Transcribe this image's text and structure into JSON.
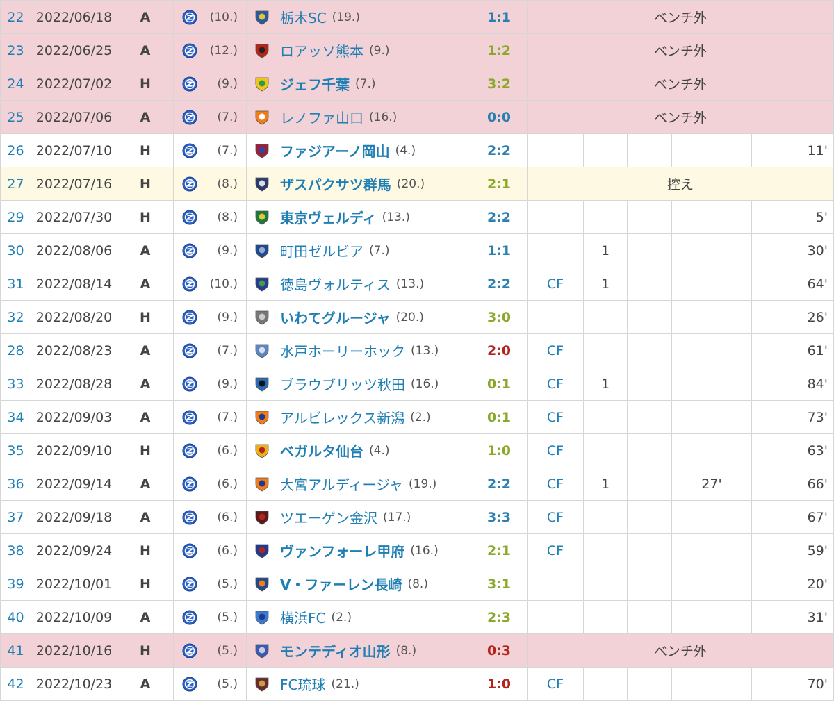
{
  "colors": {
    "win": "#8aa82a",
    "draw": "#2a7fb0",
    "loss": "#b3241b",
    "bench_bg": "#f2d2d7",
    "reserve_bg": "#fdf9e3",
    "link": "#1f7fb4"
  },
  "rows": [
    {
      "num": "22",
      "date": "2022/06/18",
      "ha": "A",
      "own_rank": "(10.)",
      "opp": "栃木SC",
      "opp_rank": "(19.)",
      "score": "1:1",
      "result": "draw",
      "status": "ベンチ外",
      "opp_icon": "tochigi-crest",
      "home": false
    },
    {
      "num": "23",
      "date": "2022/06/25",
      "ha": "A",
      "own_rank": "(12.)",
      "opp": "ロアッソ熊本",
      "opp_rank": "(9.)",
      "score": "1:2",
      "result": "win",
      "status": "ベンチ外",
      "opp_icon": "kumamoto-crest",
      "home": false
    },
    {
      "num": "24",
      "date": "2022/07/02",
      "ha": "H",
      "own_rank": "(9.)",
      "opp": "ジェフ千葉",
      "opp_rank": "(7.)",
      "score": "3:2",
      "result": "win",
      "status": "ベンチ外",
      "opp_icon": "chiba-crest",
      "home": true
    },
    {
      "num": "25",
      "date": "2022/07/06",
      "ha": "A",
      "own_rank": "(7.)",
      "opp": "レノファ山口",
      "opp_rank": "(16.)",
      "score": "0:0",
      "result": "draw",
      "status": "ベンチ外",
      "opp_icon": "yamaguchi-crest",
      "home": false
    },
    {
      "num": "26",
      "date": "2022/07/10",
      "ha": "H",
      "own_rank": "(7.)",
      "opp": "ファジアーノ岡山",
      "opp_rank": "(4.)",
      "score": "2:2",
      "result": "draw",
      "pos": "",
      "goals": "",
      "ast": "",
      "in": "",
      "min": "11'",
      "opp_icon": "okayama-crest",
      "home": true
    },
    {
      "num": "27",
      "date": "2022/07/16",
      "ha": "H",
      "own_rank": "(8.)",
      "opp": "ザスパクサツ群馬",
      "opp_rank": "(20.)",
      "score": "2:1",
      "result": "win",
      "status": "控え",
      "reserve": true,
      "opp_icon": "gunma-crest",
      "home": true
    },
    {
      "num": "29",
      "date": "2022/07/30",
      "ha": "H",
      "own_rank": "(8.)",
      "opp": "東京ヴェルディ",
      "opp_rank": "(13.)",
      "score": "2:2",
      "result": "draw",
      "pos": "",
      "goals": "",
      "ast": "",
      "in": "",
      "min": "5'",
      "opp_icon": "verdy-crest",
      "home": true
    },
    {
      "num": "30",
      "date": "2022/08/06",
      "ha": "A",
      "own_rank": "(9.)",
      "opp": "町田ゼルビア",
      "opp_rank": "(7.)",
      "score": "1:1",
      "result": "draw",
      "pos": "",
      "goals": "1",
      "ast": "",
      "in": "",
      "min": "30'",
      "opp_icon": "machida-crest",
      "home": false
    },
    {
      "num": "31",
      "date": "2022/08/14",
      "ha": "A",
      "own_rank": "(10.)",
      "opp": "徳島ヴォルティス",
      "opp_rank": "(13.)",
      "score": "2:2",
      "result": "draw",
      "pos": "CF",
      "goals": "1",
      "ast": "",
      "in": "",
      "min": "64'",
      "opp_icon": "tokushima-crest",
      "home": false
    },
    {
      "num": "32",
      "date": "2022/08/20",
      "ha": "H",
      "own_rank": "(9.)",
      "opp": "いわてグルージャ",
      "opp_rank": "(20.)",
      "score": "3:0",
      "result": "win",
      "pos": "",
      "goals": "",
      "ast": "",
      "in": "",
      "min": "26'",
      "opp_icon": "iwate-crest",
      "home": true
    },
    {
      "num": "28",
      "date": "2022/08/23",
      "ha": "A",
      "own_rank": "(7.)",
      "opp": "水戸ホーリーホック",
      "opp_rank": "(13.)",
      "score": "2:0",
      "result": "loss",
      "pos": "CF",
      "goals": "",
      "ast": "",
      "in": "",
      "min": "61'",
      "opp_icon": "mito-crest",
      "home": false
    },
    {
      "num": "33",
      "date": "2022/08/28",
      "ha": "A",
      "own_rank": "(9.)",
      "opp": "ブラウブリッツ秋田",
      "opp_rank": "(16.)",
      "score": "0:1",
      "result": "win",
      "pos": "CF",
      "goals": "1",
      "ast": "",
      "in": "",
      "min": "84'",
      "opp_icon": "akita-crest",
      "home": false
    },
    {
      "num": "34",
      "date": "2022/09/03",
      "ha": "A",
      "own_rank": "(7.)",
      "opp": "アルビレックス新潟",
      "opp_rank": "(2.)",
      "score": "0:1",
      "result": "win",
      "pos": "CF",
      "goals": "",
      "ast": "",
      "in": "",
      "min": "73'",
      "opp_icon": "niigata-crest",
      "home": false
    },
    {
      "num": "35",
      "date": "2022/09/10",
      "ha": "H",
      "own_rank": "(6.)",
      "opp": "ベガルタ仙台",
      "opp_rank": "(4.)",
      "score": "1:0",
      "result": "win",
      "pos": "CF",
      "goals": "",
      "ast": "",
      "in": "",
      "min": "63'",
      "opp_icon": "sendai-crest",
      "home": true
    },
    {
      "num": "36",
      "date": "2022/09/14",
      "ha": "A",
      "own_rank": "(6.)",
      "opp": "大宮アルディージャ",
      "opp_rank": "(19.)",
      "score": "2:2",
      "result": "draw",
      "pos": "CF",
      "goals": "1",
      "ast": "",
      "in": "27'",
      "min": "66'",
      "opp_icon": "omiya-crest",
      "home": false
    },
    {
      "num": "37",
      "date": "2022/09/18",
      "ha": "A",
      "own_rank": "(6.)",
      "opp": "ツエーゲン金沢",
      "opp_rank": "(17.)",
      "score": "3:3",
      "result": "draw",
      "pos": "CF",
      "goals": "",
      "ast": "",
      "in": "",
      "min": "67'",
      "opp_icon": "kanazawa-crest",
      "home": false
    },
    {
      "num": "38",
      "date": "2022/09/24",
      "ha": "H",
      "own_rank": "(6.)",
      "opp": "ヴァンフォーレ甲府",
      "opp_rank": "(16.)",
      "score": "2:1",
      "result": "win",
      "pos": "CF",
      "goals": "",
      "ast": "",
      "in": "",
      "min": "59'",
      "opp_icon": "kofu-crest",
      "home": true
    },
    {
      "num": "39",
      "date": "2022/10/01",
      "ha": "H",
      "own_rank": "(5.)",
      "opp": "V・ファーレン長崎",
      "opp_rank": "(8.)",
      "score": "3:1",
      "result": "win",
      "pos": "",
      "goals": "",
      "ast": "",
      "in": "",
      "min": "20'",
      "opp_icon": "nagasaki-crest",
      "home": true
    },
    {
      "num": "40",
      "date": "2022/10/09",
      "ha": "A",
      "own_rank": "(5.)",
      "opp": "横浜FC",
      "opp_rank": "(2.)",
      "score": "2:3",
      "result": "win",
      "pos": "",
      "goals": "",
      "ast": "",
      "in": "",
      "min": "31'",
      "opp_icon": "yokohamafc-crest",
      "home": false
    },
    {
      "num": "41",
      "date": "2022/10/16",
      "ha": "H",
      "own_rank": "(5.)",
      "opp": "モンテディオ山形",
      "opp_rank": "(8.)",
      "score": "0:3",
      "result": "loss",
      "status": "ベンチ外",
      "opp_icon": "yamagata-crest",
      "home": true
    },
    {
      "num": "42",
      "date": "2022/10/23",
      "ha": "A",
      "own_rank": "(5.)",
      "opp": "FC琉球",
      "opp_rank": "(21.)",
      "score": "1:0",
      "result": "loss",
      "pos": "CF",
      "goals": "",
      "ast": "",
      "in": "",
      "min": "70'",
      "opp_icon": "ryukyu-crest",
      "home": false
    }
  ]
}
